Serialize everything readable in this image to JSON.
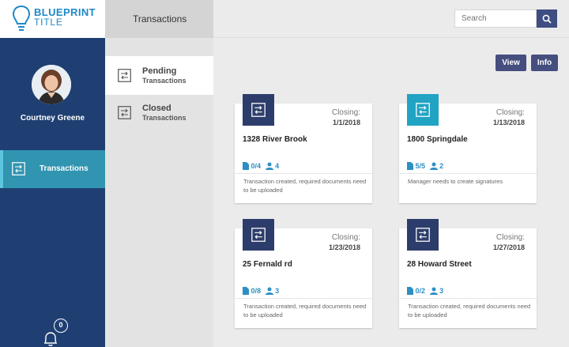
{
  "app": {
    "logo_title": "BLUEPRINT",
    "logo_subtitle": "TITLE"
  },
  "user": {
    "name": "Courtney Greene"
  },
  "sidebar": {
    "items": [
      {
        "label": "Transactions",
        "icon": "swap-icon"
      }
    ]
  },
  "notifications": {
    "count": "0"
  },
  "section": {
    "title": "Transactions",
    "items": [
      {
        "line1": "Pending",
        "line2": "Transactions",
        "icon": "swap-icon"
      },
      {
        "line1": "Closed",
        "line2": "Transactions",
        "icon": "swap-icon"
      }
    ]
  },
  "search": {
    "placeholder": "Search"
  },
  "toolbar": {
    "view_label": "View",
    "info_label": "Info"
  },
  "cards": [
    {
      "closing_label": "Closing:",
      "closing_date": "1/1/2018",
      "address": "1328 River Brook",
      "docs": "0/4",
      "people": "4",
      "note": "Transaction created, required documents need to be uploaded",
      "tile_color": "#2d3d6b"
    },
    {
      "closing_label": "Closing:",
      "closing_date": "1/13/2018",
      "address": "1800 Springdale",
      "docs": "5/5",
      "people": "2",
      "note": "Manager needs to create signatures",
      "tile_color": "#21a3c4"
    },
    {
      "closing_label": "Closing:",
      "closing_date": "1/23/2018",
      "address": "25 Fernald rd",
      "docs": "0/8",
      "people": "3",
      "note": "Transaction created, required documents need to be uploaded",
      "tile_color": "#2d3d6b"
    },
    {
      "closing_label": "Closing:",
      "closing_date": "1/27/2018",
      "address": "28 Howard Street",
      "docs": "0/2",
      "people": "3",
      "note": "Transaction created, required documents need to be uploaded",
      "tile_color": "#2d3d6b"
    }
  ],
  "colors": {
    "sidebar": "#1f3f73",
    "accent": "#3194b0",
    "button": "#454e7e",
    "link": "#2c8fc4"
  }
}
